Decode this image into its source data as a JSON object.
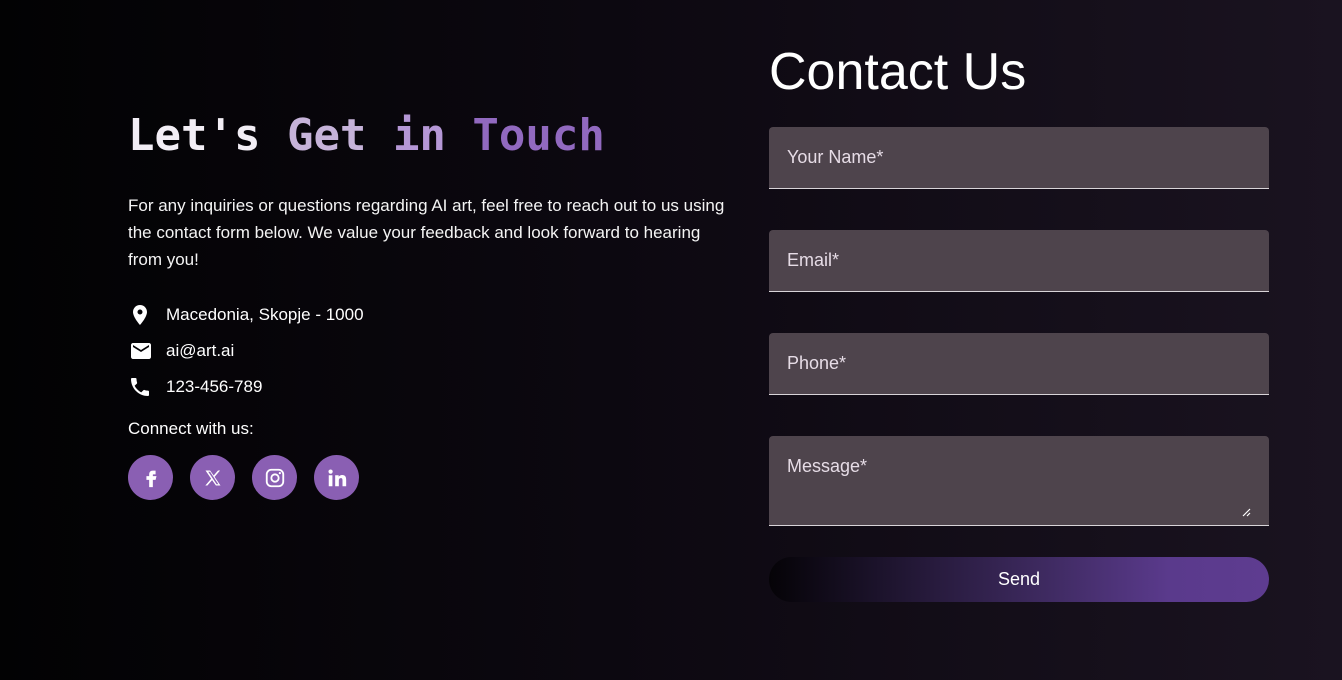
{
  "left": {
    "heading_words": [
      "Let's",
      "Get",
      "in",
      "Touch"
    ],
    "intro": "For any inquiries or questions regarding AI art, feel free to reach out to us using the contact form below. We value your feedback and look forward to hearing from you!",
    "contacts": {
      "location": "Macedonia, Skopje - 1000",
      "email": "ai@art.ai",
      "phone": "123-456-789"
    },
    "connect_label": "Connect with us:",
    "socials": [
      "facebook-icon",
      "x-icon",
      "instagram-icon",
      "linkedin-icon"
    ]
  },
  "form": {
    "title": "Contact Us",
    "name_placeholder": "Your Name*",
    "email_placeholder": "Email*",
    "phone_placeholder": "Phone*",
    "message_placeholder": "Message*",
    "send_label": "Send"
  },
  "colors": {
    "accent": "#8a5fb3",
    "field_bg": "#4e444c",
    "heading_get": "#c6b3d9",
    "heading_touch": "#9169bf"
  }
}
